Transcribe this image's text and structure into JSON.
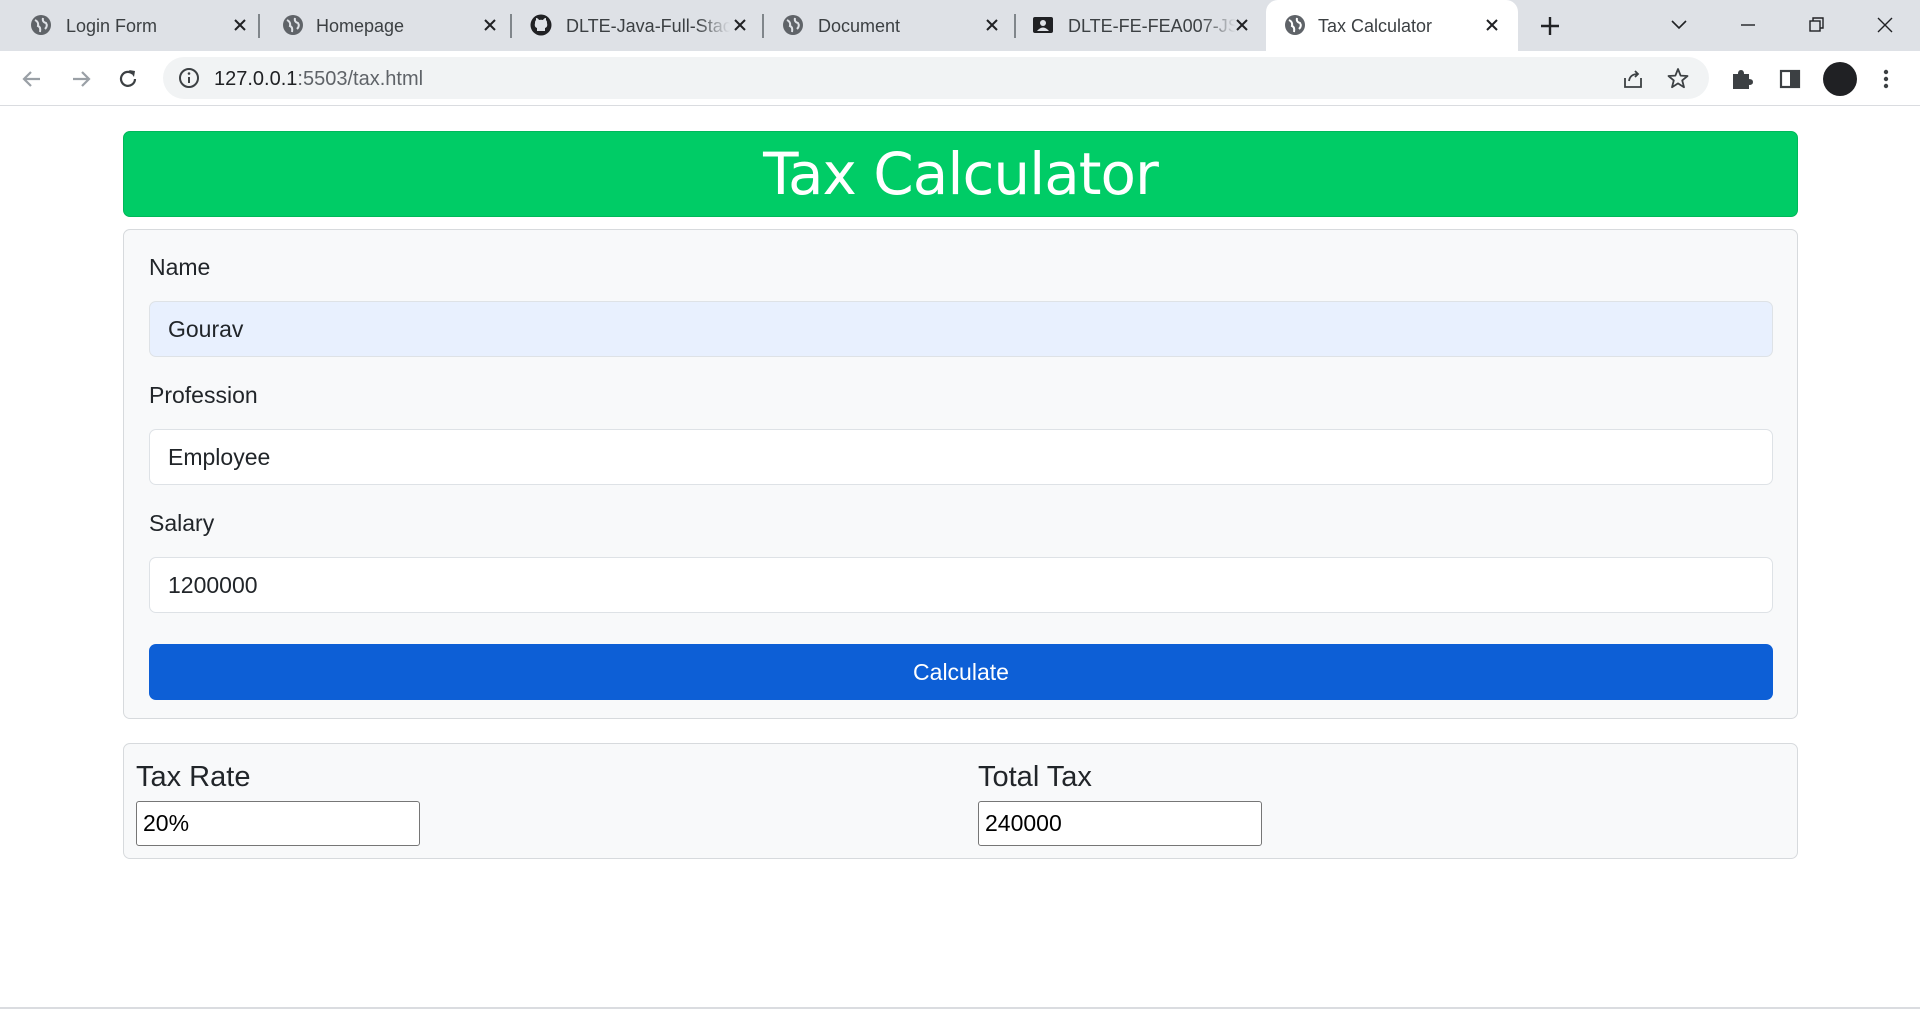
{
  "browser": {
    "tabs": [
      {
        "title": "Login Form",
        "icon": "globe-icon",
        "active": false
      },
      {
        "title": "Homepage",
        "icon": "globe-icon",
        "active": false
      },
      {
        "title": "DLTE-Java-Full-Stac",
        "icon": "github-icon",
        "active": false
      },
      {
        "title": "Document",
        "icon": "globe-icon",
        "active": false
      },
      {
        "title": "DLTE-FE-FEA007-JS",
        "icon": "contact-card-icon",
        "active": false
      },
      {
        "title": "Tax Calculator",
        "icon": "globe-icon",
        "active": true
      }
    ],
    "url_host": "127.0.0.1",
    "url_rest": ":5503/tax.html"
  },
  "page": {
    "header_title": "Tax Calculator",
    "form": {
      "name_label": "Name",
      "name_value": "Gourav",
      "profession_label": "Profession",
      "profession_value": "Employee",
      "salary_label": "Salary",
      "salary_value": "1200000",
      "calculate_label": "Calculate"
    },
    "result": {
      "tax_rate_label": "Tax Rate",
      "tax_rate_value": "20%",
      "total_tax_label": "Total Tax",
      "total_tax_value": "240000"
    }
  },
  "colors": {
    "header_bg": "#00cc66",
    "button_bg": "#0d5fd6",
    "autofill_bg": "#e8f0fe"
  }
}
